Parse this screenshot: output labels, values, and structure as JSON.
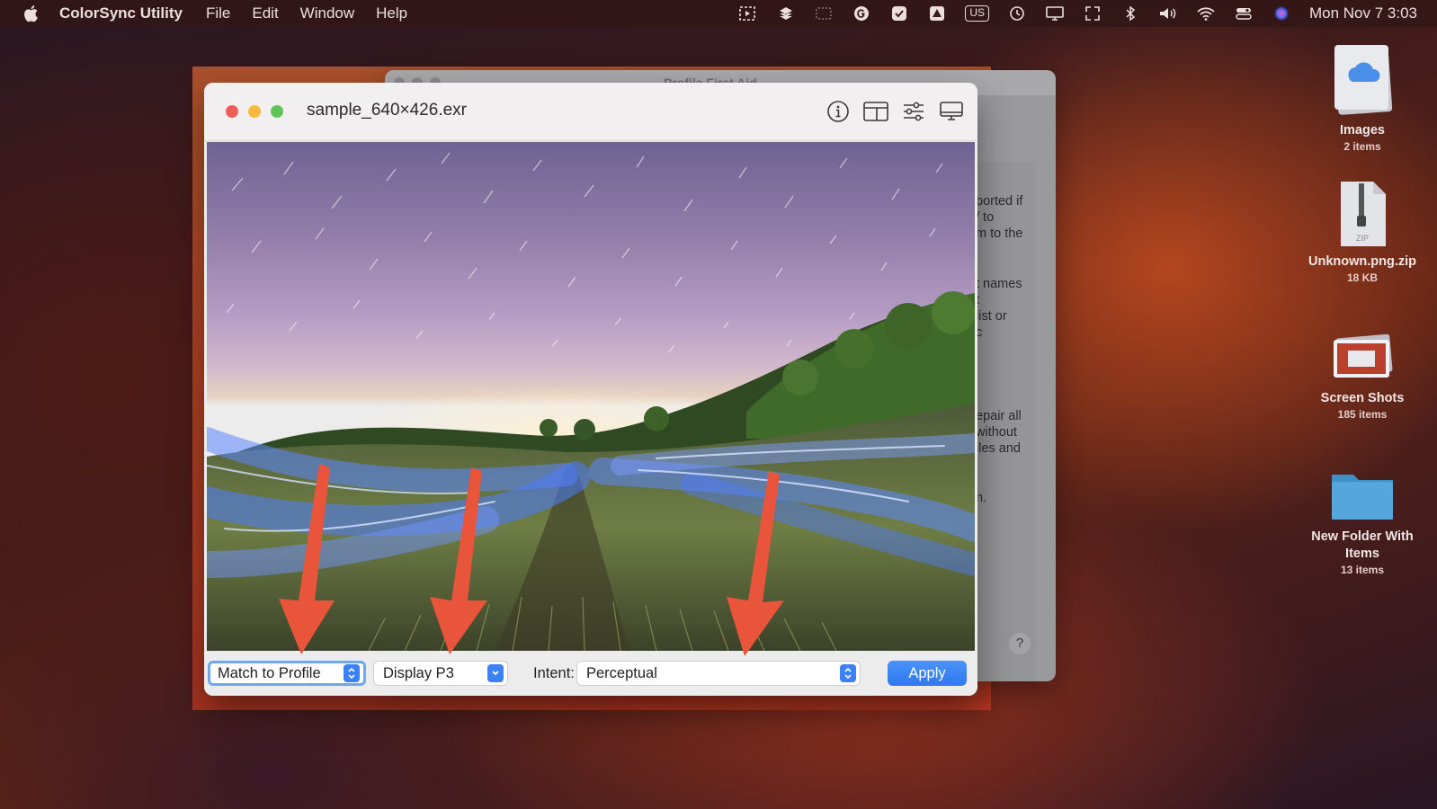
{
  "menubar": {
    "app_name": "ColorSync Utility",
    "menus": [
      "File",
      "Edit",
      "Window",
      "Help"
    ],
    "keyboard_layout": "US",
    "clock": "Mon Nov 7  3:03"
  },
  "background_window": {
    "title": "Profile First Aid",
    "text_fragments": [
      "ported if",
      "/ to",
      "m to the",
      "t names",
      "t",
      " list or",
      "c",
      "epair all",
      "without",
      "iles and",
      "n."
    ],
    "help_label": "?"
  },
  "window": {
    "title": "sample_640×426.exr",
    "toolbar_icons": [
      "info-icon",
      "split-view-icon",
      "sliders-icon",
      "display-icon"
    ]
  },
  "bottom_bar": {
    "mode_select": "Match to Profile",
    "profile_select": "Display P3",
    "intent_label": "Intent:",
    "intent_select": "Perceptual",
    "apply_label": "Apply"
  },
  "desktop": {
    "items": [
      {
        "name": "Images",
        "sub": "2 items",
        "icon": "icloud-folder-icon"
      },
      {
        "name": "Unknown.png.zip",
        "sub": "18 KB",
        "icon": "zip-file-icon"
      },
      {
        "name": "Screen Shots",
        "sub": "185 items",
        "icon": "screenshot-stack-icon"
      },
      {
        "name": "New Folder With Items",
        "sub": "13 items",
        "icon": "folder-icon"
      }
    ]
  },
  "colors": {
    "accent": "#3a80f6",
    "annotation_arrow": "#e8553a",
    "close": "#ef5d58",
    "minimize": "#f4b93e",
    "maximize": "#5fc455"
  }
}
